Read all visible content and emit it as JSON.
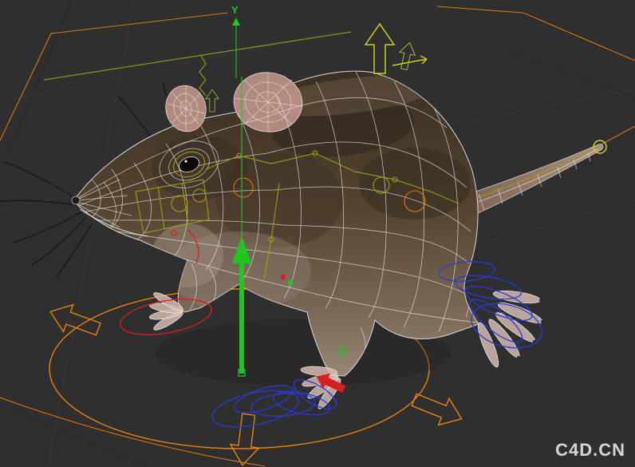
{
  "viewport": {
    "watermark": "C4D.CN",
    "axis_label_y": "Y"
  },
  "colors": {
    "background": "#2f2f2f",
    "grid": "#3a3a3a",
    "wireframe": "#e6e6e6",
    "body_brown": "#54432f",
    "ear_pink": "#bc9288",
    "controller_orange": "#e8820c",
    "controller_blue": "#2b3bd4",
    "axis_green": "#21c421",
    "axis_red": "#d42020",
    "bone_yellow": "#9aa018",
    "watermark_gray": "#e2e2e2"
  }
}
